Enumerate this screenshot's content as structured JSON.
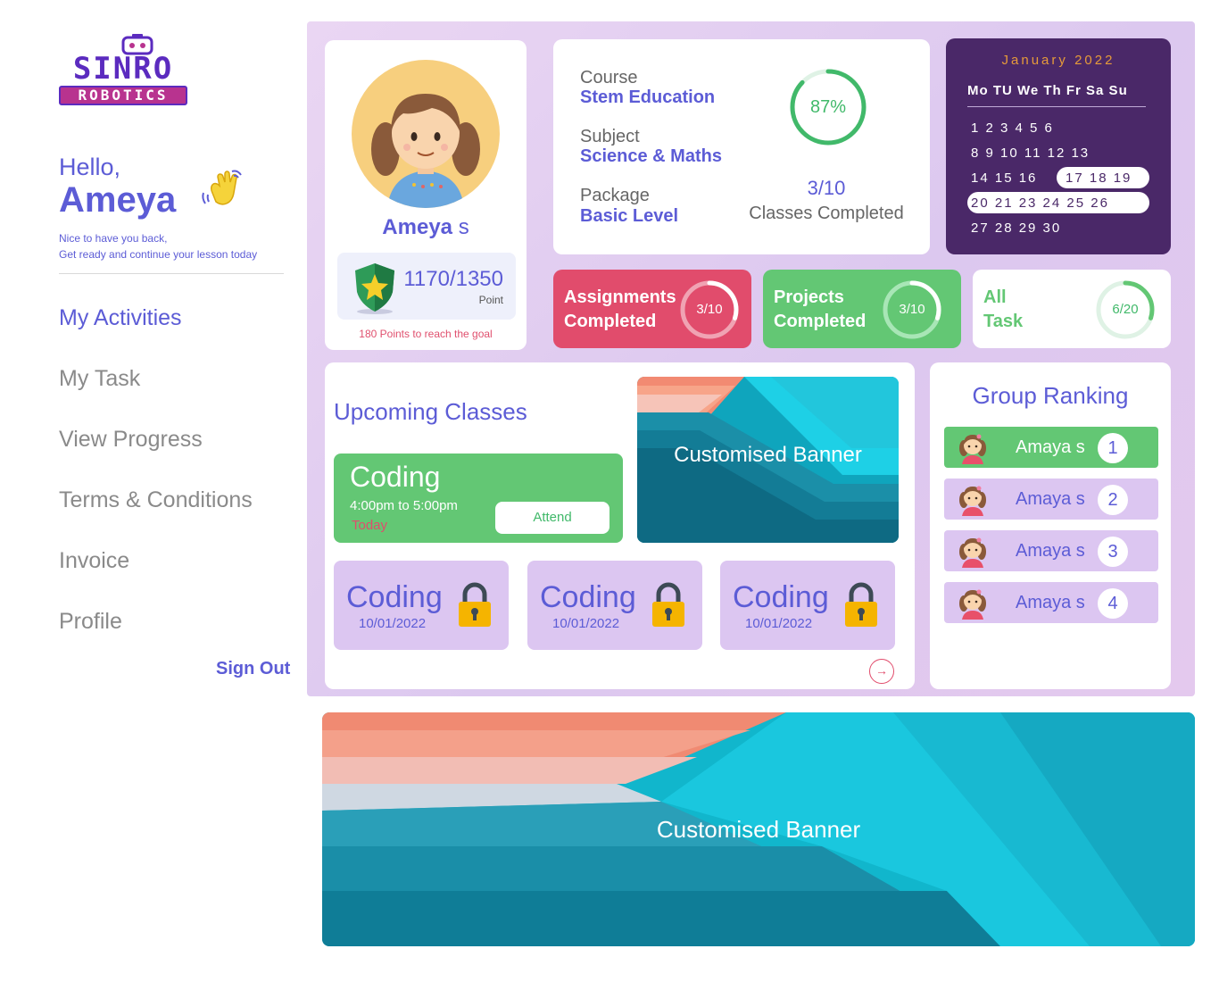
{
  "brand": {
    "line1": "SINRO",
    "line2": "ROBOTICS"
  },
  "greeting": {
    "hello": "Hello,",
    "name": "Ameya",
    "welcome_line1": "Nice to have you back,",
    "welcome_line2": "Get ready and continue your lesson today"
  },
  "nav": {
    "items": [
      "My Activities",
      "My Task",
      "View Progress",
      "Terms & Conditions",
      "Invoice",
      "Profile"
    ],
    "active": "My Activities",
    "sign_out": "Sign Out"
  },
  "profile": {
    "first_name": "Ameya",
    "last_initial": "s",
    "points": "1170/1350",
    "points_label": "Point",
    "goal_text": "180 Points to reach the goal"
  },
  "course": {
    "course_label": "Course",
    "course_value": "Stem Education",
    "subject_label": "Subject",
    "subject_value": "Science & Maths",
    "package_label": "Package",
    "package_value": "Basic Level",
    "progress_text": "87%",
    "progress_value": 0.87,
    "classes_fraction": "3/10",
    "classes_label": "Classes Completed"
  },
  "calendar": {
    "month": "January",
    "year": "2022",
    "weekdays": "Mo TU We Th Fr Sa Su",
    "rows": [
      "1   2   3   4   5   6",
      "8   9  10  11  12  13",
      "14  15  16",
      "17  18  19",
      "20  21  23  24  25  26",
      "27  28  29  30"
    ]
  },
  "stats": {
    "assignments": {
      "line1": "Assignments",
      "line2": "Completed",
      "value": "3/10",
      "fraction": 0.3
    },
    "projects": {
      "line1": "Projects",
      "line2": "Completed",
      "value": "3/10",
      "fraction": 0.3
    },
    "all_task": {
      "line1": "All",
      "line2": "Task",
      "value": "6/20",
      "fraction": 0.3
    }
  },
  "upcoming": {
    "title": "Upcoming Classes",
    "next": {
      "title": "Coding",
      "time": "4:00pm to 5:00pm",
      "day": "Today",
      "button": "Attend"
    },
    "locked": [
      {
        "title": "Coding",
        "date": "10/01/2022"
      },
      {
        "title": "Coding",
        "date": "10/01/2022"
      },
      {
        "title": "Coding",
        "date": "10/01/2022"
      }
    ],
    "banner_text": "Customised Banner"
  },
  "ranking": {
    "title": "Group Ranking",
    "rows": [
      {
        "name": "Amaya s",
        "rank": "1"
      },
      {
        "name": "Amaya s",
        "rank": "2"
      },
      {
        "name": "Amaya s",
        "rank": "3"
      },
      {
        "name": "Amaya s",
        "rank": "4"
      }
    ]
  },
  "bottom_banner": {
    "text": "Customised Banner"
  },
  "colors": {
    "accent": "#5c5cd6",
    "green": "#63c774",
    "pink": "#e14c6c",
    "calendar_bg": "#4a2868",
    "calendar_title": "#e69a3a"
  }
}
